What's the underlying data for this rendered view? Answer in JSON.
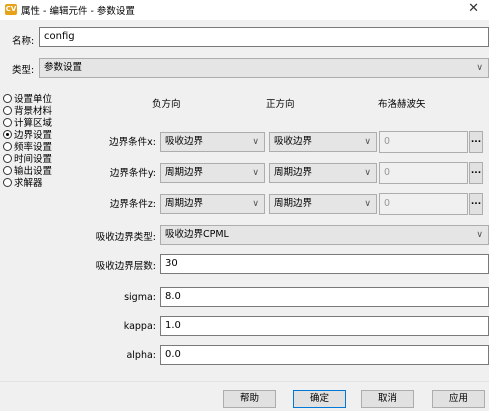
{
  "window": {
    "title": "属性 - 编辑元件 - 参数设置",
    "close_glyph": "✕",
    "icon_text": "CV"
  },
  "name_field": {
    "label": "名称:",
    "value": "config"
  },
  "type_field": {
    "label": "类型:",
    "value": "参数设置"
  },
  "nav": {
    "items": [
      {
        "label": "设置单位",
        "selected": false
      },
      {
        "label": "背景材料",
        "selected": false
      },
      {
        "label": "计算区域",
        "selected": false
      },
      {
        "label": "边界设置",
        "selected": true
      },
      {
        "label": "频率设置",
        "selected": false
      },
      {
        "label": "时间设置",
        "selected": false
      },
      {
        "label": "输出设置",
        "selected": false
      },
      {
        "label": "求解器",
        "selected": false
      }
    ]
  },
  "columns": {
    "negative": "负方向",
    "positive": "正方向",
    "bloch": "布洛赫波矢"
  },
  "boundaries": [
    {
      "label": "边界条件x:",
      "negative": "吸收边界",
      "positive": "吸收边界",
      "bloch": "0"
    },
    {
      "label": "边界条件y:",
      "negative": "周期边界",
      "positive": "周期边界",
      "bloch": "0"
    },
    {
      "label": "边界条件z:",
      "negative": "周期边界",
      "positive": "周期边界",
      "bloch": "0"
    }
  ],
  "ellipsis_label": "...",
  "absorb_type": {
    "label": "吸收边界类型:",
    "value": "吸收边界CPML"
  },
  "absorb_layers": {
    "label": "吸收边界层数:",
    "value": "30"
  },
  "sigma": {
    "label": "sigma:",
    "value": "8.0"
  },
  "kappa": {
    "label": "kappa:",
    "value": "1.0"
  },
  "alpha": {
    "label": "alpha:",
    "value": "0.0"
  },
  "buttons": {
    "help": "帮助",
    "ok": "确定",
    "cancel": "取消",
    "apply": "应用"
  },
  "chevron_glyph": "∨"
}
